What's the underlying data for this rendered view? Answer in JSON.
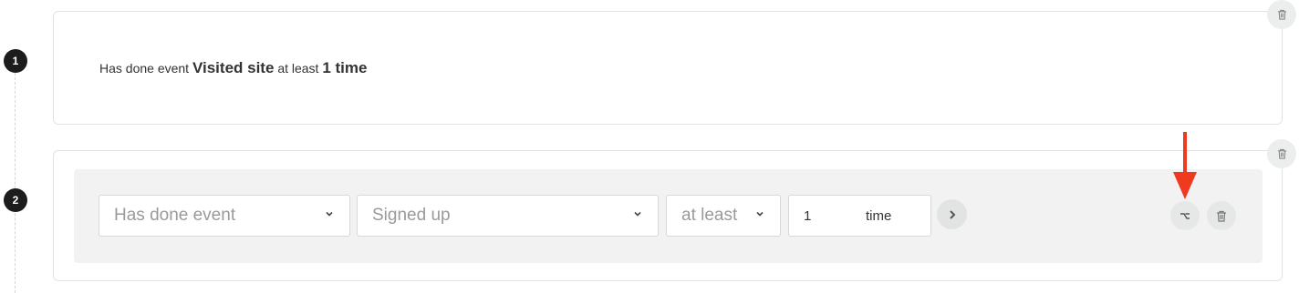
{
  "steps": [
    {
      "number": "1",
      "summary": {
        "prefix": "Has done event",
        "event": "Visited site",
        "operator": "at least",
        "count": "1 time"
      }
    },
    {
      "number": "2",
      "editor": {
        "type_select": "Has done event",
        "event_select": "Signed up",
        "operator_select": "at least",
        "count_value": "1",
        "count_unit": "time"
      }
    }
  ],
  "icons": {
    "delete": "trash-icon",
    "next": "chevron-right-icon",
    "branch": "branch-icon",
    "dropdown": "chevron-down-icon",
    "annotation": "red-arrow"
  },
  "colors": {
    "step_badge": "#1c1c1c",
    "editor_bg": "#f2f2f2",
    "annotation_arrow": "#f03a1f"
  }
}
